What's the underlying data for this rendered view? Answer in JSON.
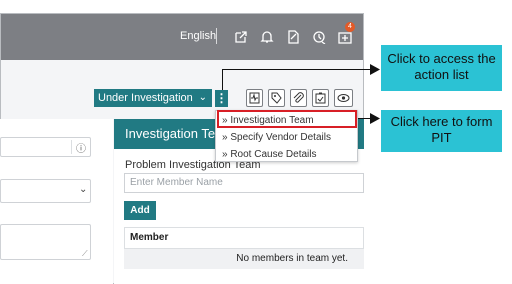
{
  "topbar": {
    "language": "English",
    "notification_count": "4",
    "icons": [
      "external-link-icon",
      "bell-icon",
      "file-search-icon",
      "history-icon",
      "add-note-icon"
    ]
  },
  "toolbar": {
    "status_label": "Under Investigation",
    "action_menu_glyph": "⋮",
    "tool_icons": [
      "pulse-icon",
      "tag-icon",
      "paperclip-icon",
      "clipboard-check-icon",
      "eye-icon"
    ]
  },
  "action_menu": {
    "items": [
      {
        "label": "» Investigation Team"
      },
      {
        "label": "» Specify Vendor Details"
      },
      {
        "label": "» Root Cause Details"
      }
    ]
  },
  "panel": {
    "title": "Investigation Team",
    "field_label": "Problem Investigation Team",
    "field_placeholder": "Enter Member Name",
    "add_label": "Add",
    "table_header": "Member",
    "empty_text": "No members in team yet."
  },
  "annotations": {
    "callout_action": "Click to access the action list",
    "callout_pit": "Click here to form PIT"
  },
  "colors": {
    "teal": "#217a83",
    "callout": "#2bc2d4",
    "highlight": "#d81f26",
    "topbar": "#7d7f84"
  }
}
